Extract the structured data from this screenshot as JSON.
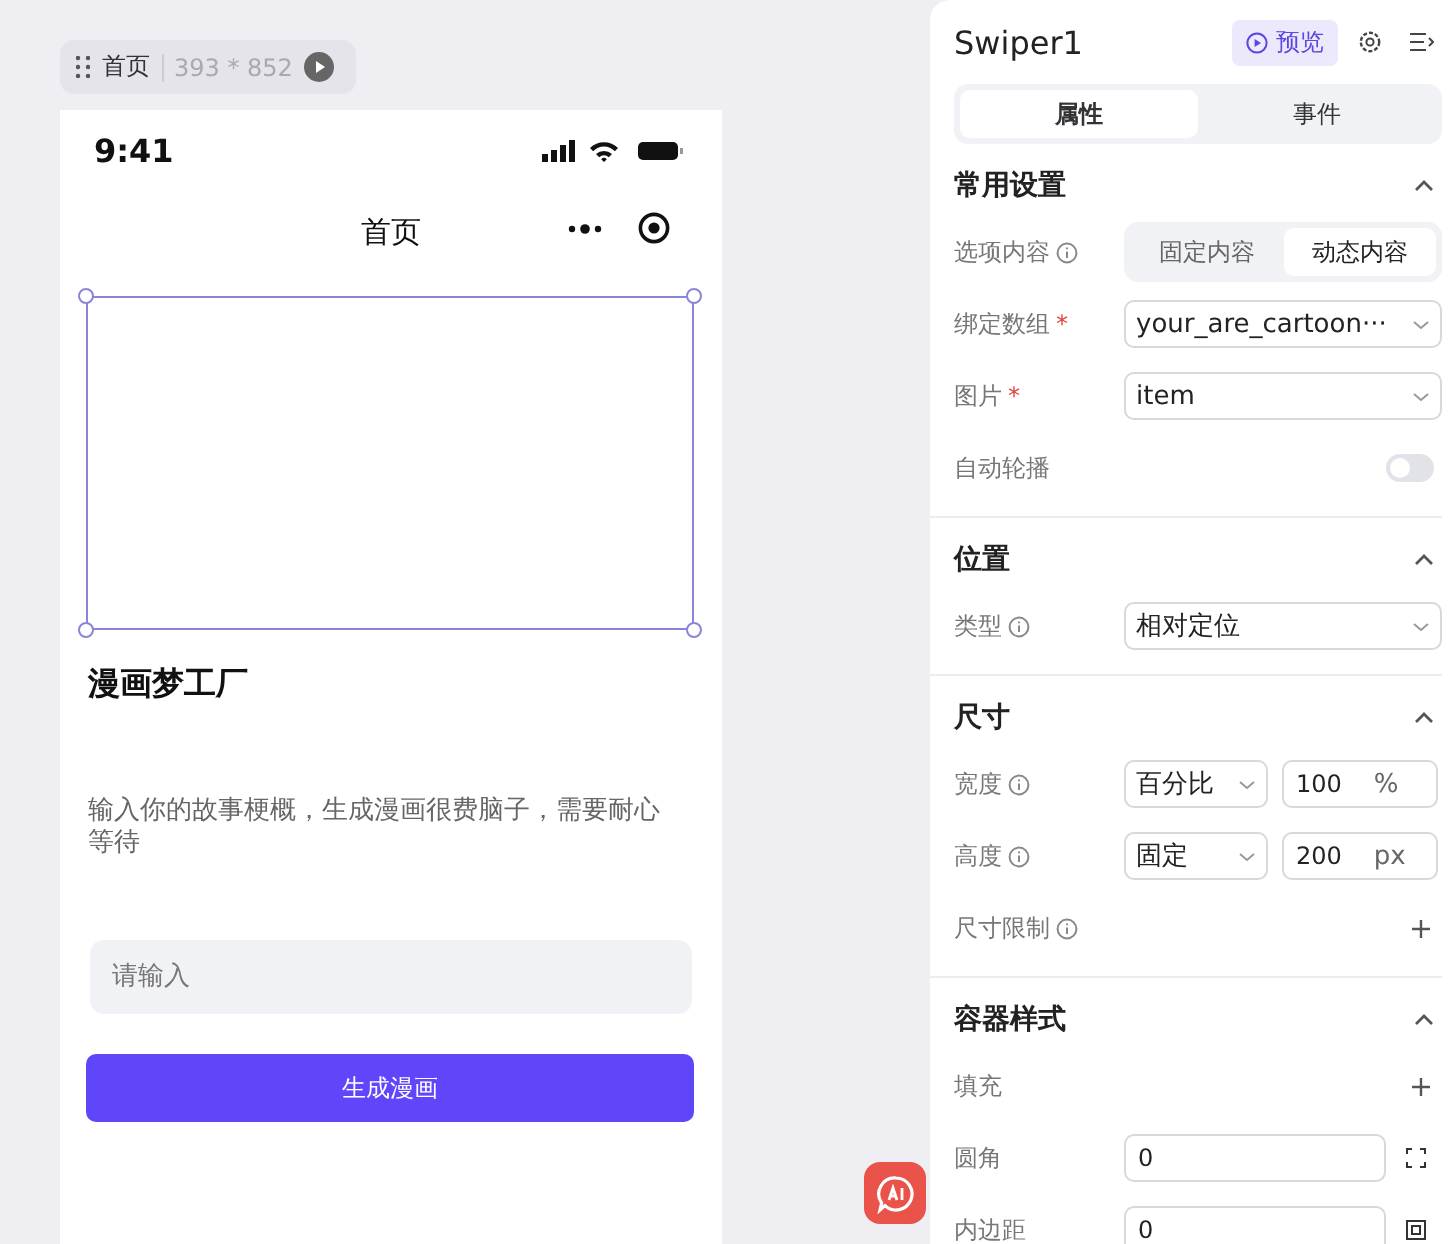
{
  "canvas": {
    "page_tag": {
      "name": "首页",
      "size": "393 * 852"
    },
    "phone": {
      "time": "9:41",
      "nav_title": "首页",
      "title": "漫画梦工厂",
      "description": "输入你的故事梗概，生成漫画很费脑子，需要耐心等待",
      "input_placeholder": "请输入",
      "button": "生成漫画"
    }
  },
  "panel": {
    "component_name": "Swiper1",
    "preview_button": "预览",
    "tabs": [
      {
        "label": "属性",
        "selected": true
      },
      {
        "label": "事件",
        "selected": false
      }
    ],
    "sections": [
      {
        "title": "常用设置",
        "expanded": true,
        "rows": [
          {
            "kind": "segmented",
            "label": "选项内容",
            "info": true,
            "options": [
              {
                "label": "固定内容",
                "selected": false
              },
              {
                "label": "动态内容",
                "selected": true
              }
            ]
          },
          {
            "kind": "select",
            "label": "绑定数组",
            "info": false,
            "required_mark": "*",
            "value": "your_are_cartoon···"
          },
          {
            "kind": "select",
            "label": "图片",
            "info": false,
            "required_mark": "*",
            "value": "item"
          },
          {
            "kind": "toggle",
            "label": "自动轮播",
            "info": false,
            "on": false
          }
        ]
      },
      {
        "title": "位置",
        "expanded": true,
        "rows": [
          {
            "kind": "select",
            "label": "类型",
            "info": true,
            "value": "相对定位"
          }
        ]
      },
      {
        "title": "尺寸",
        "expanded": true,
        "rows": [
          {
            "kind": "unit",
            "label": "宽度",
            "info": true,
            "mode": "百分比",
            "value": "100",
            "unit": "%"
          },
          {
            "kind": "unit",
            "label": "高度",
            "info": true,
            "mode": "固定",
            "value": "200",
            "unit": "px"
          },
          {
            "kind": "add",
            "label": "尺寸限制",
            "info": true
          }
        ]
      },
      {
        "title": "容器样式",
        "expanded": true,
        "rows": [
          {
            "kind": "add",
            "label": "填充",
            "info": false
          },
          {
            "kind": "radius",
            "label": "圆角",
            "info": false,
            "value": "0"
          },
          {
            "kind": "padding",
            "label": "内边距",
            "info": false,
            "value": "0"
          }
        ]
      }
    ]
  }
}
